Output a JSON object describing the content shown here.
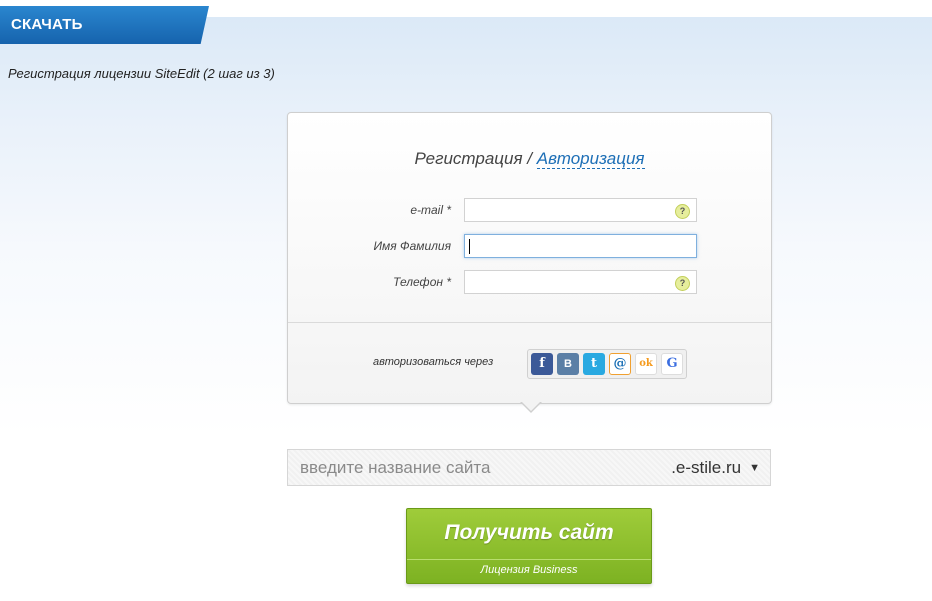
{
  "tab": {
    "label": "СКАЧАТЬ"
  },
  "subtitle": "Регистрация лицензии SiteEdit (2 шаг из 3)",
  "panel": {
    "title_register": "Регистрация",
    "title_sep": " / ",
    "title_login": "Авторизация",
    "fields": [
      {
        "label": "e-mail *",
        "value": "",
        "help": "?"
      },
      {
        "label": "Имя Фамилия",
        "value": ""
      },
      {
        "label": "Телефон *",
        "value": "",
        "help": "?"
      }
    ],
    "social_label": "авторизоваться через",
    "social": [
      {
        "icon": "facebook-icon",
        "glyph": "f",
        "color": "#3b5998"
      },
      {
        "icon": "vkontakte-icon",
        "glyph": "В",
        "color": "#5b7fa6"
      },
      {
        "icon": "twitter-icon",
        "glyph": "t",
        "color": "#29a9e1"
      },
      {
        "icon": "mailru-icon",
        "glyph": "@",
        "color": "#1a6fb5"
      },
      {
        "icon": "odnoklassniki-icon",
        "glyph": "ok",
        "color": "#f59a1c"
      },
      {
        "icon": "google-icon",
        "glyph": "G",
        "color": "#3b6ee0"
      }
    ]
  },
  "site": {
    "placeholder": "введите название сайта",
    "domain": ".e-stile.ru"
  },
  "button": {
    "label": "Получить сайт",
    "sublabel": "Лицензия Business"
  }
}
